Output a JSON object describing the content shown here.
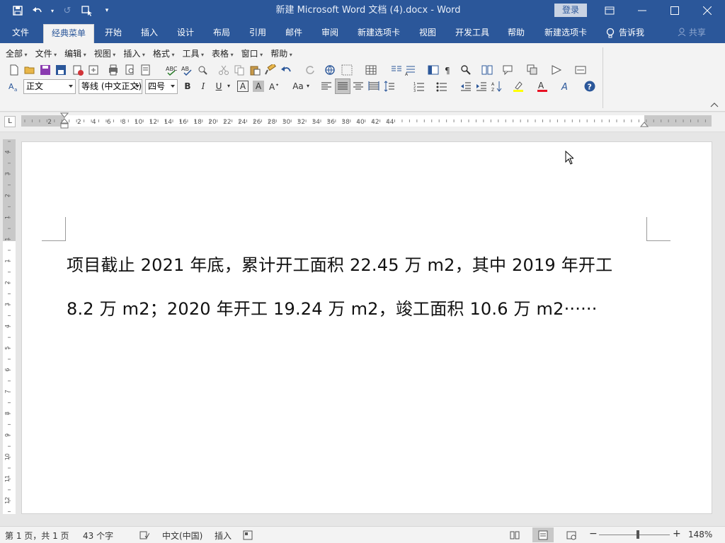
{
  "app": {
    "doc_title": "新建 Microsoft Word 文档 (4).docx  -  Word",
    "login_label": "登录"
  },
  "tabs": [
    {
      "label": "文件"
    },
    {
      "label": "经典菜单",
      "active": true
    },
    {
      "label": "开始"
    },
    {
      "label": "插入"
    },
    {
      "label": "设计"
    },
    {
      "label": "布局"
    },
    {
      "label": "引用"
    },
    {
      "label": "邮件"
    },
    {
      "label": "审阅"
    },
    {
      "label": "新建选项卡"
    },
    {
      "label": "视图"
    },
    {
      "label": "开发工具"
    },
    {
      "label": "帮助"
    },
    {
      "label": "新建选项卡"
    }
  ],
  "tell_me": "告诉我",
  "share": "共享",
  "classic_menu": [
    "全部",
    "文件",
    "编辑",
    "视图",
    "插入",
    "格式",
    "工具",
    "表格",
    "窗口",
    "帮助"
  ],
  "format_bar": {
    "style_value": "正文",
    "font_value": "等线 (中文正文)",
    "size_value": "四号",
    "bold": "B",
    "italic": "I",
    "underline": "U",
    "char_border": "A",
    "char_shade": "A",
    "change_case": "Aa",
    "font_color": "#e81123",
    "highlight_color": "#ffff00"
  },
  "ruler": {
    "h_labels": [
      "2",
      "2",
      "4",
      "6",
      "8",
      "10",
      "12",
      "14",
      "16",
      "18",
      "20",
      "22",
      "24",
      "26",
      "28",
      "30",
      "32",
      "34",
      "36",
      "38",
      "40",
      "42",
      "44"
    ],
    "v_labels": [
      "4",
      "3",
      "2",
      "1",
      "1",
      "1",
      "2",
      "3",
      "4",
      "5",
      "6",
      "7",
      "8",
      "9",
      "10",
      "11",
      "12"
    ]
  },
  "document": {
    "line1": "项目截止 2021 年底，累计开工面积 22.45 万 m2，其中 2019 年开工",
    "line2": "8.2 万 m2；2020 年开工 19.24 万 m2，竣工面积 10.6 万 m2······"
  },
  "status": {
    "page": "第 1 页，共 1 页",
    "words": "43 个字",
    "language": "中文(中国)",
    "mode": "插入",
    "zoom": "148%",
    "zoom_minus": "−",
    "zoom_plus": "+"
  },
  "colors": {
    "title_blue": "#2b579a",
    "ribbon_bg": "#f3f3f3"
  }
}
